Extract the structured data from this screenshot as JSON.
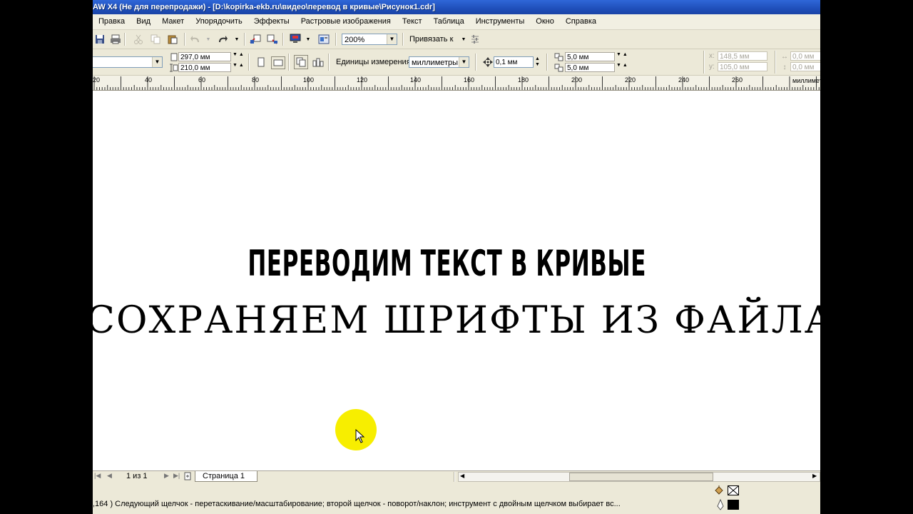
{
  "window": {
    "title": "AW X4 (Не для перепродажи) - [D:\\kopirka-ekb.ru\\видео\\перевод в кривые\\Рисунок1.cdr]"
  },
  "menu": [
    "Правка",
    "Вид",
    "Макет",
    "Упорядочить",
    "Эффекты",
    "Растровые изображения",
    "Текст",
    "Таблица",
    "Инструменты",
    "Окно",
    "Справка"
  ],
  "toolbar": {
    "zoom": "200%",
    "snap_label": "Привязать к"
  },
  "property_bar": {
    "page_width": "297,0 мм",
    "page_height": "210,0 мм",
    "units_label": "Единицы измерения:",
    "units_value": "миллиметры",
    "nudge": "0,1 мм",
    "dup_x": "5,0 мм",
    "dup_y": "5,0 мм",
    "pos_x_label": "x:",
    "pos_x": "148,5 мм",
    "pos_y_label": "y:",
    "pos_y": "105,0 мм",
    "size_w": "0,0 мм",
    "size_h": "0,0 мм"
  },
  "ruler": {
    "labels": [
      "20",
      "40",
      "60",
      "80",
      "100",
      "120",
      "140",
      "160",
      "180",
      "200",
      "220",
      "240",
      "260"
    ],
    "unit": "миллимет"
  },
  "canvas": {
    "line1": "ПЕРЕВОДИМ ТЕКСТ  В КРИВЫЕ",
    "line2": "СОХРАНЯЕМ ШРИФТЫ ИЗ ФАЙЛА"
  },
  "pages": {
    "counter": "1 из 1",
    "tab": "Страница 1"
  },
  "status": {
    "text": ",164 )   Следующий щелчок - перетаскивание/масштабирование; второй щелчок - поворот/наклон; инструмент с двойным щелчком выбирает вс..."
  },
  "colors": {
    "title_bar": "#1f4fba",
    "window_bg": "#ece9d8",
    "cursor_highlight": "#f7ee00"
  }
}
